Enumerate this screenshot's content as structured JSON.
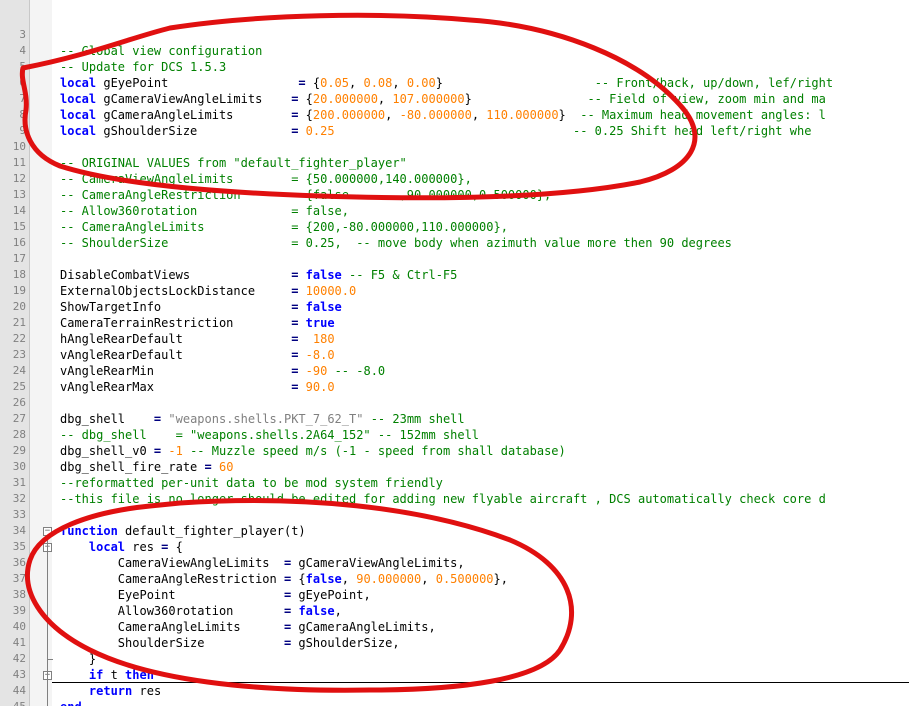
{
  "lines": [
    {
      "n": "3",
      "segs": []
    },
    {
      "n": "4",
      "segs": [
        {
          "t": "-- Global view configuration",
          "c": "cm"
        }
      ]
    },
    {
      "n": "5",
      "segs": [
        {
          "t": "-- Update for DCS 1.5.3",
          "c": "cm"
        }
      ]
    },
    {
      "n": "6",
      "segs": [
        {
          "t": "local",
          "c": "kw"
        },
        {
          "t": " gEyePoint                  "
        },
        {
          "t": "=",
          "c": "op"
        },
        {
          "t": " {"
        },
        {
          "t": "0.05",
          "c": "num"
        },
        {
          "t": ", "
        },
        {
          "t": "0.08",
          "c": "num"
        },
        {
          "t": ", "
        },
        {
          "t": "0.00",
          "c": "num"
        },
        {
          "t": "}                     "
        },
        {
          "t": "-- Front/back, up/down, lef/right",
          "c": "cm"
        }
      ]
    },
    {
      "n": "7",
      "segs": [
        {
          "t": "local",
          "c": "kw"
        },
        {
          "t": " gCameraViewAngleLimits    "
        },
        {
          "t": "=",
          "c": "op"
        },
        {
          "t": " {"
        },
        {
          "t": "20.000000",
          "c": "num"
        },
        {
          "t": ", "
        },
        {
          "t": "107.000000",
          "c": "num"
        },
        {
          "t": "}                "
        },
        {
          "t": "-- Field of view, zoom min and ma",
          "c": "cm"
        }
      ]
    },
    {
      "n": "8",
      "segs": [
        {
          "t": "local",
          "c": "kw"
        },
        {
          "t": " gCameraAngleLimits        "
        },
        {
          "t": "=",
          "c": "op"
        },
        {
          "t": " {"
        },
        {
          "t": "200.000000",
          "c": "num"
        },
        {
          "t": ", "
        },
        {
          "t": "-80.000000",
          "c": "num"
        },
        {
          "t": ", "
        },
        {
          "t": "110.000000",
          "c": "num"
        },
        {
          "t": "}  "
        },
        {
          "t": "-- Maximum head movement angles: l",
          "c": "cm"
        }
      ]
    },
    {
      "n": "9",
      "segs": [
        {
          "t": "local",
          "c": "kw"
        },
        {
          "t": " gShoulderSize             "
        },
        {
          "t": "=",
          "c": "op"
        },
        {
          "t": " "
        },
        {
          "t": "0.25",
          "c": "num"
        },
        {
          "t": "                                 "
        },
        {
          "t": "-- 0.25 Shift head left/right whe",
          "c": "cm"
        }
      ]
    },
    {
      "n": "10",
      "segs": []
    },
    {
      "n": "11",
      "segs": [
        {
          "t": "-- ORIGINAL VALUES from \"default_fighter_player\"",
          "c": "cm"
        }
      ]
    },
    {
      "n": "12",
      "segs": [
        {
          "t": "-- CameraViewAngleLimits        = {50.000000,140.000000},",
          "c": "cm"
        }
      ]
    },
    {
      "n": "13",
      "segs": [
        {
          "t": "-- CameraAngleRestriction       = {false       ,90.000000,0.500000},",
          "c": "cm"
        }
      ]
    },
    {
      "n": "14",
      "segs": [
        {
          "t": "-- Allow360rotation             = false,",
          "c": "cm"
        }
      ]
    },
    {
      "n": "15",
      "segs": [
        {
          "t": "-- CameraAngleLimits            = {200,-80.000000,110.000000},",
          "c": "cm"
        }
      ]
    },
    {
      "n": "16",
      "segs": [
        {
          "t": "-- ShoulderSize                 = 0.25,  -- move body when azimuth value more then 90 degrees",
          "c": "cm"
        }
      ]
    },
    {
      "n": "17",
      "segs": []
    },
    {
      "n": "18",
      "segs": [
        {
          "t": "DisableCombatViews              "
        },
        {
          "t": "=",
          "c": "op"
        },
        {
          "t": " "
        },
        {
          "t": "false",
          "c": "kw"
        },
        {
          "t": " "
        },
        {
          "t": "-- F5 & Ctrl-F5",
          "c": "cm"
        }
      ]
    },
    {
      "n": "19",
      "segs": [
        {
          "t": "ExternalObjectsLockDistance     "
        },
        {
          "t": "=",
          "c": "op"
        },
        {
          "t": " "
        },
        {
          "t": "10000.0",
          "c": "num"
        }
      ]
    },
    {
      "n": "20",
      "segs": [
        {
          "t": "ShowTargetInfo                  "
        },
        {
          "t": "=",
          "c": "op"
        },
        {
          "t": " "
        },
        {
          "t": "false",
          "c": "kw"
        }
      ]
    },
    {
      "n": "21",
      "segs": [
        {
          "t": "CameraTerrainRestriction        "
        },
        {
          "t": "=",
          "c": "op"
        },
        {
          "t": " "
        },
        {
          "t": "true",
          "c": "kw"
        }
      ]
    },
    {
      "n": "22",
      "segs": [
        {
          "t": "hAngleRearDefault               "
        },
        {
          "t": "=",
          "c": "op"
        },
        {
          "t": "  "
        },
        {
          "t": "180",
          "c": "num"
        }
      ]
    },
    {
      "n": "23",
      "segs": [
        {
          "t": "vAngleRearDefault               "
        },
        {
          "t": "=",
          "c": "op"
        },
        {
          "t": " "
        },
        {
          "t": "-8.0",
          "c": "num"
        }
      ]
    },
    {
      "n": "24",
      "segs": [
        {
          "t": "vAngleRearMin                   "
        },
        {
          "t": "=",
          "c": "op"
        },
        {
          "t": " "
        },
        {
          "t": "-90",
          "c": "num"
        },
        {
          "t": " "
        },
        {
          "t": "-- -8.0",
          "c": "cm"
        }
      ]
    },
    {
      "n": "25",
      "segs": [
        {
          "t": "vAngleRearMax                   "
        },
        {
          "t": "=",
          "c": "op"
        },
        {
          "t": " "
        },
        {
          "t": "90.0",
          "c": "num"
        }
      ]
    },
    {
      "n": "26",
      "segs": []
    },
    {
      "n": "27",
      "segs": [
        {
          "t": "dbg_shell    "
        },
        {
          "t": "=",
          "c": "op"
        },
        {
          "t": " "
        },
        {
          "t": "\"weapons.shells.PKT_7_62_T\"",
          "c": "str"
        },
        {
          "t": " "
        },
        {
          "t": "-- 23mm shell",
          "c": "cm"
        }
      ]
    },
    {
      "n": "28",
      "segs": [
        {
          "t": "-- dbg_shell    = \"weapons.shells.2A64_152\" -- 152mm shell",
          "c": "cm"
        }
      ]
    },
    {
      "n": "29",
      "segs": [
        {
          "t": "dbg_shell_v0 "
        },
        {
          "t": "=",
          "c": "op"
        },
        {
          "t": " "
        },
        {
          "t": "-1",
          "c": "num"
        },
        {
          "t": " "
        },
        {
          "t": "-- Muzzle speed m/s (-1 - speed from shall database)",
          "c": "cm"
        }
      ]
    },
    {
      "n": "30",
      "segs": [
        {
          "t": "dbg_shell_fire_rate "
        },
        {
          "t": "=",
          "c": "op"
        },
        {
          "t": " "
        },
        {
          "t": "60",
          "c": "num"
        }
      ]
    },
    {
      "n": "31",
      "segs": [
        {
          "t": "--reformatted per-unit data to be mod system friendly",
          "c": "cm"
        }
      ]
    },
    {
      "n": "32",
      "segs": [
        {
          "t": "--this file is no longer should be edited for adding new flyable aircraft , DCS automatically check core d",
          "c": "cm"
        }
      ]
    },
    {
      "n": "33",
      "segs": []
    },
    {
      "n": "34",
      "segs": [
        {
          "t": "function",
          "c": "kw"
        },
        {
          "t": " default_fighter_player(t)"
        }
      ]
    },
    {
      "n": "35",
      "segs": [
        {
          "t": "    "
        },
        {
          "t": "local",
          "c": "kw"
        },
        {
          "t": " res "
        },
        {
          "t": "=",
          "c": "op"
        },
        {
          "t": " {"
        }
      ]
    },
    {
      "n": "36",
      "segs": [
        {
          "t": "        CameraViewAngleLimits  "
        },
        {
          "t": "=",
          "c": "op"
        },
        {
          "t": " gCameraViewAngleLimits,"
        }
      ]
    },
    {
      "n": "37",
      "segs": [
        {
          "t": "        CameraAngleRestriction "
        },
        {
          "t": "=",
          "c": "op"
        },
        {
          "t": " {"
        },
        {
          "t": "false",
          "c": "kw"
        },
        {
          "t": ", "
        },
        {
          "t": "90.000000",
          "c": "num"
        },
        {
          "t": ", "
        },
        {
          "t": "0.500000",
          "c": "num"
        },
        {
          "t": "},"
        }
      ]
    },
    {
      "n": "38",
      "segs": [
        {
          "t": "        EyePoint               "
        },
        {
          "t": "=",
          "c": "op"
        },
        {
          "t": " gEyePoint,"
        }
      ]
    },
    {
      "n": "39",
      "segs": [
        {
          "t": "        Allow360rotation       "
        },
        {
          "t": "=",
          "c": "op"
        },
        {
          "t": " "
        },
        {
          "t": "false",
          "c": "kw"
        },
        {
          "t": ","
        }
      ]
    },
    {
      "n": "40",
      "segs": [
        {
          "t": "        CameraAngleLimits      "
        },
        {
          "t": "=",
          "c": "op"
        },
        {
          "t": " gCameraAngleLimits,"
        }
      ]
    },
    {
      "n": "41",
      "segs": [
        {
          "t": "        ShoulderSize           "
        },
        {
          "t": "=",
          "c": "op"
        },
        {
          "t": " gShoulderSize,"
        }
      ]
    },
    {
      "n": "42",
      "segs": [
        {
          "t": "    }"
        }
      ]
    },
    {
      "n": "43",
      "segs": [
        {
          "t": "    "
        },
        {
          "t": "if",
          "c": "kw"
        },
        {
          "t": " t "
        },
        {
          "t": "then",
          "c": "kw"
        }
      ]
    },
    {
      "n": "44",
      "segs": [
        {
          "t": "    "
        },
        {
          "t": "return",
          "c": "kw"
        },
        {
          "t": " res"
        }
      ]
    },
    {
      "n": "45",
      "segs": [
        {
          "t": "end",
          "c": "kw"
        }
      ]
    }
  ],
  "annotation_color": "#e01010"
}
